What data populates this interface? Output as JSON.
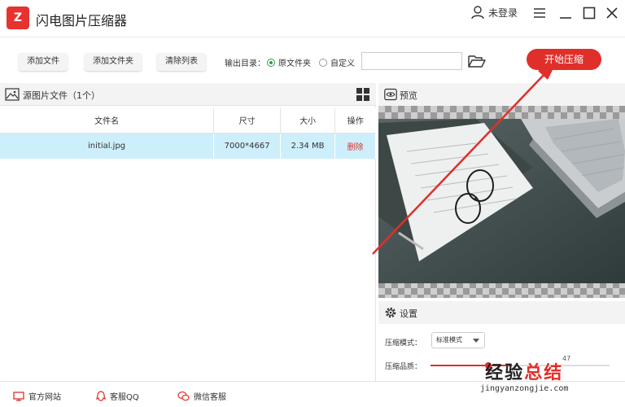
{
  "app": {
    "title": "闪电图片压缩器",
    "user_label": "未登录"
  },
  "toolbar": {
    "add_file": "添加文件",
    "add_folder": "添加文件夹",
    "clear_list": "清除列表",
    "output_label": "输出目录：",
    "radio_original": "原文件夹",
    "radio_custom": "自定义",
    "path_value": "",
    "start_button": "开始压缩"
  },
  "source_panel": {
    "title": "源图片文件（1个）",
    "columns": [
      "文件名",
      "尺寸",
      "大小",
      "操作"
    ],
    "rows": [
      {
        "name": "initial.jpg",
        "size": "7000*4667",
        "filesize": "2.34 MB",
        "action": "删除"
      }
    ]
  },
  "preview_panel": {
    "title": "预览"
  },
  "settings_panel": {
    "title": "设置",
    "mode_label": "压缩模式：",
    "mode_value": "标准模式",
    "quality_label": "压缩品质：",
    "quality_value": "47"
  },
  "footer": {
    "website": "官方网站",
    "qq": "客服QQ",
    "wechat": "微信客服"
  },
  "watermark": {
    "line1a": "经验",
    "line1b": "总结",
    "line2": "jingyanzongjie.com"
  },
  "colors": {
    "accent": "#e02f2a",
    "row_highlight": "#cdeffc",
    "radio_on": "#2aa04a"
  }
}
